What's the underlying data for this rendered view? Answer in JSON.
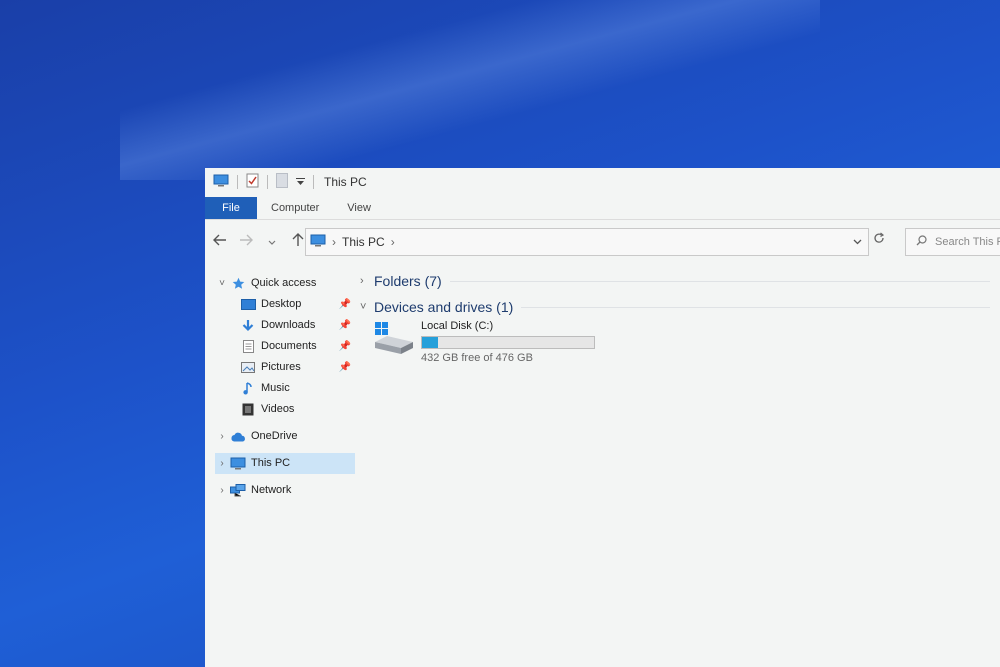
{
  "window": {
    "title": "This PC",
    "ribbon_tabs": [
      "File",
      "Computer",
      "View"
    ]
  },
  "navbar": {
    "back_icon": "arrow-left-icon",
    "forward_icon": "arrow-right-icon",
    "recent_icon": "chevron-down-icon",
    "up_icon": "arrow-up-icon",
    "address_location": "This PC",
    "search_placeholder": "Search This P"
  },
  "sidebar": {
    "quick_access": "Quick access",
    "quick_items": [
      {
        "label": "Desktop",
        "icon": "desktop-icon",
        "pinned": true
      },
      {
        "label": "Downloads",
        "icon": "downloads-icon",
        "pinned": true
      },
      {
        "label": "Documents",
        "icon": "documents-icon",
        "pinned": true
      },
      {
        "label": "Pictures",
        "icon": "pictures-icon",
        "pinned": true
      },
      {
        "label": "Music",
        "icon": "music-icon",
        "pinned": false
      },
      {
        "label": "Videos",
        "icon": "videos-icon",
        "pinned": false
      }
    ],
    "onedrive": "OneDrive",
    "this_pc": "This PC",
    "network": "Network"
  },
  "content": {
    "folders_header": "Folders (7)",
    "devices_header": "Devices and drives (1)",
    "drive": {
      "name": "Local Disk (C:)",
      "free_text": "432 GB free of 476 GB",
      "used_fraction": 0.0924
    }
  },
  "colors": {
    "accent": "#1f5fb8",
    "selection": "#cce4f7",
    "drive_bar": "#26a0da"
  }
}
